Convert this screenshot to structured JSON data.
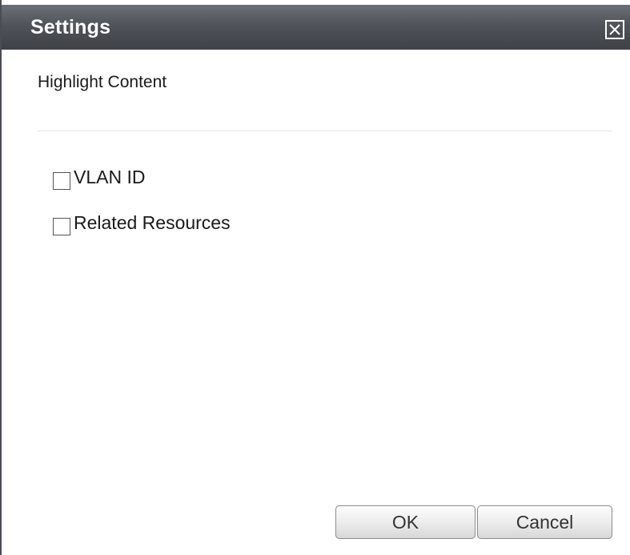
{
  "dialog": {
    "title": "Settings",
    "close_icon": "close-icon"
  },
  "section": {
    "title": "Highlight Content"
  },
  "options": [
    {
      "label": "VLAN ID",
      "checked": false
    },
    {
      "label": "Related Resources",
      "checked": false
    }
  ],
  "buttons": {
    "ok_label": "OK",
    "cancel_label": "Cancel"
  },
  "colors": {
    "titlebar_top": "#6b6f76",
    "titlebar_bottom": "#3e4146",
    "title_text": "#ffffff",
    "divider": "#e6e6e6"
  }
}
